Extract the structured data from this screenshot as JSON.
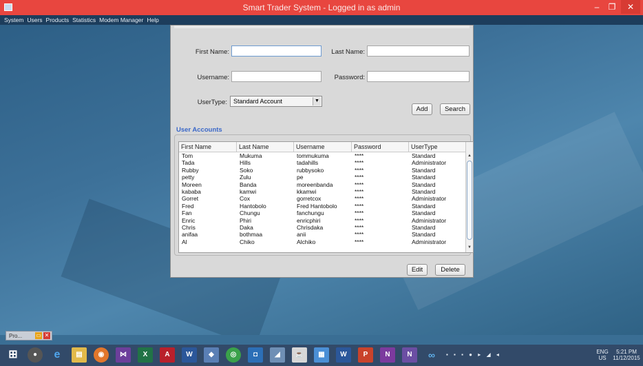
{
  "window": {
    "title": "Smart Trader System - Logged in as admin",
    "controls": {
      "minimize": "–",
      "maximize": "❐",
      "close": "✕"
    }
  },
  "menubar": [
    "System",
    "Users",
    "Products",
    "Statistics",
    "Modem Manager",
    "Help"
  ],
  "form": {
    "first_name_label": "First Name:",
    "last_name_label": "Last Name:",
    "username_label": "Username:",
    "password_label": "Password:",
    "usertype_label": "UserType:",
    "usertype_value": "Standard Account",
    "add_label": "Add",
    "search_label": "Search"
  },
  "section_title": "User Accounts",
  "table": {
    "columns": [
      "First Name",
      "Last Name",
      "Username",
      "Password",
      "UserType"
    ],
    "rows": [
      [
        "Tom",
        "Mukuma",
        "tommukuma",
        "****",
        "Standard"
      ],
      [
        "Tada",
        "Hills",
        "tadahills",
        "****",
        "Administrator"
      ],
      [
        "Rubby",
        "Soko",
        "rubbysoko",
        "****",
        "Standard"
      ],
      [
        "petty",
        "Zulu",
        "pe",
        "****",
        "Standard"
      ],
      [
        "Moreen",
        "Banda",
        "moreenbanda",
        "****",
        "Standard"
      ],
      [
        "kababa",
        "kamwi",
        "kkamwi",
        "****",
        "Standard"
      ],
      [
        "Gorret",
        "Cox",
        "gorretcox",
        "****",
        "Administrator"
      ],
      [
        "Fred",
        "Hantobolo",
        "Fred Hantobolo",
        "****",
        "Standard"
      ],
      [
        "Fan",
        "Chungu",
        "fanchungu",
        "****",
        "Standard"
      ],
      [
        "Enric",
        "Phiri",
        "enricphiri",
        "****",
        "Administrator"
      ],
      [
        "Chris",
        "Daka",
        "Chrisdaka",
        "****",
        "Standard"
      ],
      [
        "anifaa",
        "bothmaa",
        "anii",
        "****",
        "Standard"
      ],
      [
        "Al",
        "Chiko",
        "Alchiko",
        "****",
        "Administrator"
      ]
    ]
  },
  "actions": {
    "edit_label": "Edit",
    "delete_label": "Delete"
  },
  "minimized_window": {
    "label": "Pro..."
  },
  "taskbar": {
    "tray_lang": "ENG",
    "tray_region": "US",
    "time": "5:21 PM",
    "date": "11/12/2015"
  },
  "colors": {
    "title_bar": "#e8463f",
    "section_title": "#3b68c8",
    "desktop": "#3a6e94"
  }
}
